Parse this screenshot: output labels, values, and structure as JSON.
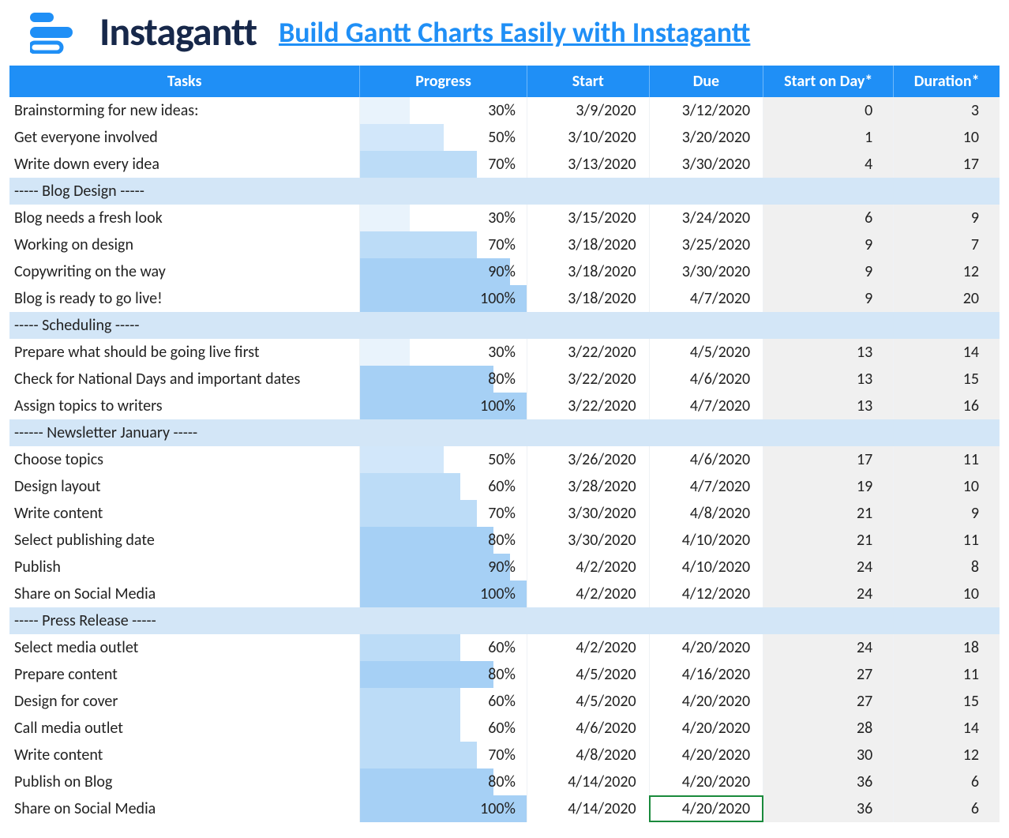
{
  "brand": {
    "name": "Instagantt",
    "accent": "#1f8ff6"
  },
  "cta": {
    "text": "Build Gantt Charts Easily with Instagantt"
  },
  "columns": {
    "tasks": "Tasks",
    "progress": "Progress",
    "start": "Start",
    "due": "Due",
    "start_day": "Start on Day*",
    "duration": "Duration*"
  },
  "rows": [
    {
      "type": "task",
      "task": "Brainstorming for new ideas:",
      "progress": 30,
      "start": "3/9/2020",
      "due": "3/12/2020",
      "start_day": 0,
      "duration": 3
    },
    {
      "type": "task",
      "task": "Get everyone involved",
      "progress": 50,
      "start": "3/10/2020",
      "due": "3/20/2020",
      "start_day": 1,
      "duration": 10
    },
    {
      "type": "task",
      "task": "Write down every idea",
      "progress": 70,
      "start": "3/13/2020",
      "due": "3/30/2020",
      "start_day": 4,
      "duration": 17
    },
    {
      "type": "section",
      "label": "----- Blog Design -----"
    },
    {
      "type": "task",
      "task": "Blog needs a fresh look",
      "progress": 30,
      "start": "3/15/2020",
      "due": "3/24/2020",
      "start_day": 6,
      "duration": 9
    },
    {
      "type": "task",
      "task": "Working on design",
      "progress": 70,
      "start": "3/18/2020",
      "due": "3/25/2020",
      "start_day": 9,
      "duration": 7
    },
    {
      "type": "task",
      "task": "Copywriting on the way",
      "progress": 90,
      "start": "3/18/2020",
      "due": "3/30/2020",
      "start_day": 9,
      "duration": 12
    },
    {
      "type": "task",
      "task": "Blog is ready to go live!",
      "progress": 100,
      "start": "3/18/2020",
      "due": "4/7/2020",
      "start_day": 9,
      "duration": 20
    },
    {
      "type": "section",
      "label": "----- Scheduling -----"
    },
    {
      "type": "task",
      "task": "Prepare what should be going live first",
      "progress": 30,
      "start": "3/22/2020",
      "due": "4/5/2020",
      "start_day": 13,
      "duration": 14
    },
    {
      "type": "task",
      "task": "Check for National Days and important dates",
      "progress": 80,
      "start": "3/22/2020",
      "due": "4/6/2020",
      "start_day": 13,
      "duration": 15
    },
    {
      "type": "task",
      "task": "Assign topics to writers",
      "progress": 100,
      "start": "3/22/2020",
      "due": "4/7/2020",
      "start_day": 13,
      "duration": 16
    },
    {
      "type": "section",
      "label": "------ Newsletter January -----"
    },
    {
      "type": "task",
      "task": "Choose topics",
      "progress": 50,
      "start": "3/26/2020",
      "due": "4/6/2020",
      "start_day": 17,
      "duration": 11
    },
    {
      "type": "task",
      "task": "Design layout",
      "progress": 60,
      "start": "3/28/2020",
      "due": "4/7/2020",
      "start_day": 19,
      "duration": 10
    },
    {
      "type": "task",
      "task": "Write content",
      "progress": 70,
      "start": "3/30/2020",
      "due": "4/8/2020",
      "start_day": 21,
      "duration": 9
    },
    {
      "type": "task",
      "task": "Select publishing date",
      "progress": 80,
      "start": "3/30/2020",
      "due": "4/10/2020",
      "start_day": 21,
      "duration": 11
    },
    {
      "type": "task",
      "task": "Publish",
      "progress": 90,
      "start": "4/2/2020",
      "due": "4/10/2020",
      "start_day": 24,
      "duration": 8
    },
    {
      "type": "task",
      "task": "Share on Social Media",
      "progress": 100,
      "start": "4/2/2020",
      "due": "4/12/2020",
      "start_day": 24,
      "duration": 10
    },
    {
      "type": "section",
      "label": "----- Press Release -----"
    },
    {
      "type": "task",
      "task": "Select media outlet",
      "progress": 60,
      "start": "4/2/2020",
      "due": "4/20/2020",
      "start_day": 24,
      "duration": 18
    },
    {
      "type": "task",
      "task": "Prepare content",
      "progress": 80,
      "start": "4/5/2020",
      "due": "4/16/2020",
      "start_day": 27,
      "duration": 11
    },
    {
      "type": "task",
      "task": "Design for cover",
      "progress": 60,
      "start": "4/5/2020",
      "due": "4/20/2020",
      "start_day": 27,
      "duration": 15
    },
    {
      "type": "task",
      "task": "Call media outlet",
      "progress": 60,
      "start": "4/6/2020",
      "due": "4/20/2020",
      "start_day": 28,
      "duration": 14
    },
    {
      "type": "task",
      "task": "Write content",
      "progress": 70,
      "start": "4/8/2020",
      "due": "4/20/2020",
      "start_day": 30,
      "duration": 12
    },
    {
      "type": "task",
      "task": "Publish on Blog",
      "progress": 80,
      "start": "4/14/2020",
      "due": "4/20/2020",
      "start_day": 36,
      "duration": 6
    },
    {
      "type": "task",
      "task": "Share on Social Media",
      "progress": 100,
      "start": "4/14/2020",
      "due": "4/20/2020",
      "start_day": 36,
      "duration": 6,
      "selected_due": true
    }
  ],
  "chart_data": {
    "type": "table",
    "title": "Gantt Chart Excel Template / Task List",
    "columns": [
      "Tasks",
      "Progress (%)",
      "Start",
      "Due",
      "Start on Day",
      "Duration (days)"
    ],
    "series": [
      {
        "name": "Brainstorming for new ideas:",
        "values": [
          30,
          "3/9/2020",
          "3/12/2020",
          0,
          3
        ]
      },
      {
        "name": "Get everyone involved",
        "values": [
          50,
          "3/10/2020",
          "3/20/2020",
          1,
          10
        ]
      },
      {
        "name": "Write down every idea",
        "values": [
          70,
          "3/13/2020",
          "3/30/2020",
          4,
          17
        ]
      },
      {
        "name": "Blog needs a fresh look",
        "values": [
          30,
          "3/15/2020",
          "3/24/2020",
          6,
          9
        ]
      },
      {
        "name": "Working on design",
        "values": [
          70,
          "3/18/2020",
          "3/25/2020",
          9,
          7
        ]
      },
      {
        "name": "Copywriting on the way",
        "values": [
          90,
          "3/18/2020",
          "3/30/2020",
          9,
          12
        ]
      },
      {
        "name": "Blog is ready to go live!",
        "values": [
          100,
          "3/18/2020",
          "4/7/2020",
          9,
          20
        ]
      },
      {
        "name": "Prepare what should be going live first",
        "values": [
          30,
          "3/22/2020",
          "4/5/2020",
          13,
          14
        ]
      },
      {
        "name": "Check for National Days and important dates",
        "values": [
          80,
          "3/22/2020",
          "4/6/2020",
          13,
          15
        ]
      },
      {
        "name": "Assign topics to writers",
        "values": [
          100,
          "3/22/2020",
          "4/7/2020",
          13,
          16
        ]
      },
      {
        "name": "Choose topics",
        "values": [
          50,
          "3/26/2020",
          "4/6/2020",
          17,
          11
        ]
      },
      {
        "name": "Design layout",
        "values": [
          60,
          "3/28/2020",
          "4/7/2020",
          19,
          10
        ]
      },
      {
        "name": "Write content",
        "values": [
          70,
          "3/30/2020",
          "4/8/2020",
          21,
          9
        ]
      },
      {
        "name": "Select publishing date",
        "values": [
          80,
          "3/30/2020",
          "4/10/2020",
          21,
          11
        ]
      },
      {
        "name": "Publish",
        "values": [
          90,
          "4/2/2020",
          "4/10/2020",
          24,
          8
        ]
      },
      {
        "name": "Share on Social Media",
        "values": [
          100,
          "4/2/2020",
          "4/12/2020",
          24,
          10
        ]
      },
      {
        "name": "Select media outlet",
        "values": [
          60,
          "4/2/2020",
          "4/20/2020",
          24,
          18
        ]
      },
      {
        "name": "Prepare content",
        "values": [
          80,
          "4/5/2020",
          "4/16/2020",
          27,
          11
        ]
      },
      {
        "name": "Design for cover",
        "values": [
          60,
          "4/5/2020",
          "4/20/2020",
          27,
          15
        ]
      },
      {
        "name": "Call media outlet",
        "values": [
          60,
          "4/6/2020",
          "4/20/2020",
          28,
          14
        ]
      },
      {
        "name": "Write content (Press)",
        "values": [
          70,
          "4/8/2020",
          "4/20/2020",
          30,
          12
        ]
      },
      {
        "name": "Publish on Blog",
        "values": [
          80,
          "4/14/2020",
          "4/20/2020",
          36,
          6
        ]
      },
      {
        "name": "Share on Social Media (Press)",
        "values": [
          100,
          "4/14/2020",
          "4/20/2020",
          36,
          6
        ]
      }
    ]
  }
}
